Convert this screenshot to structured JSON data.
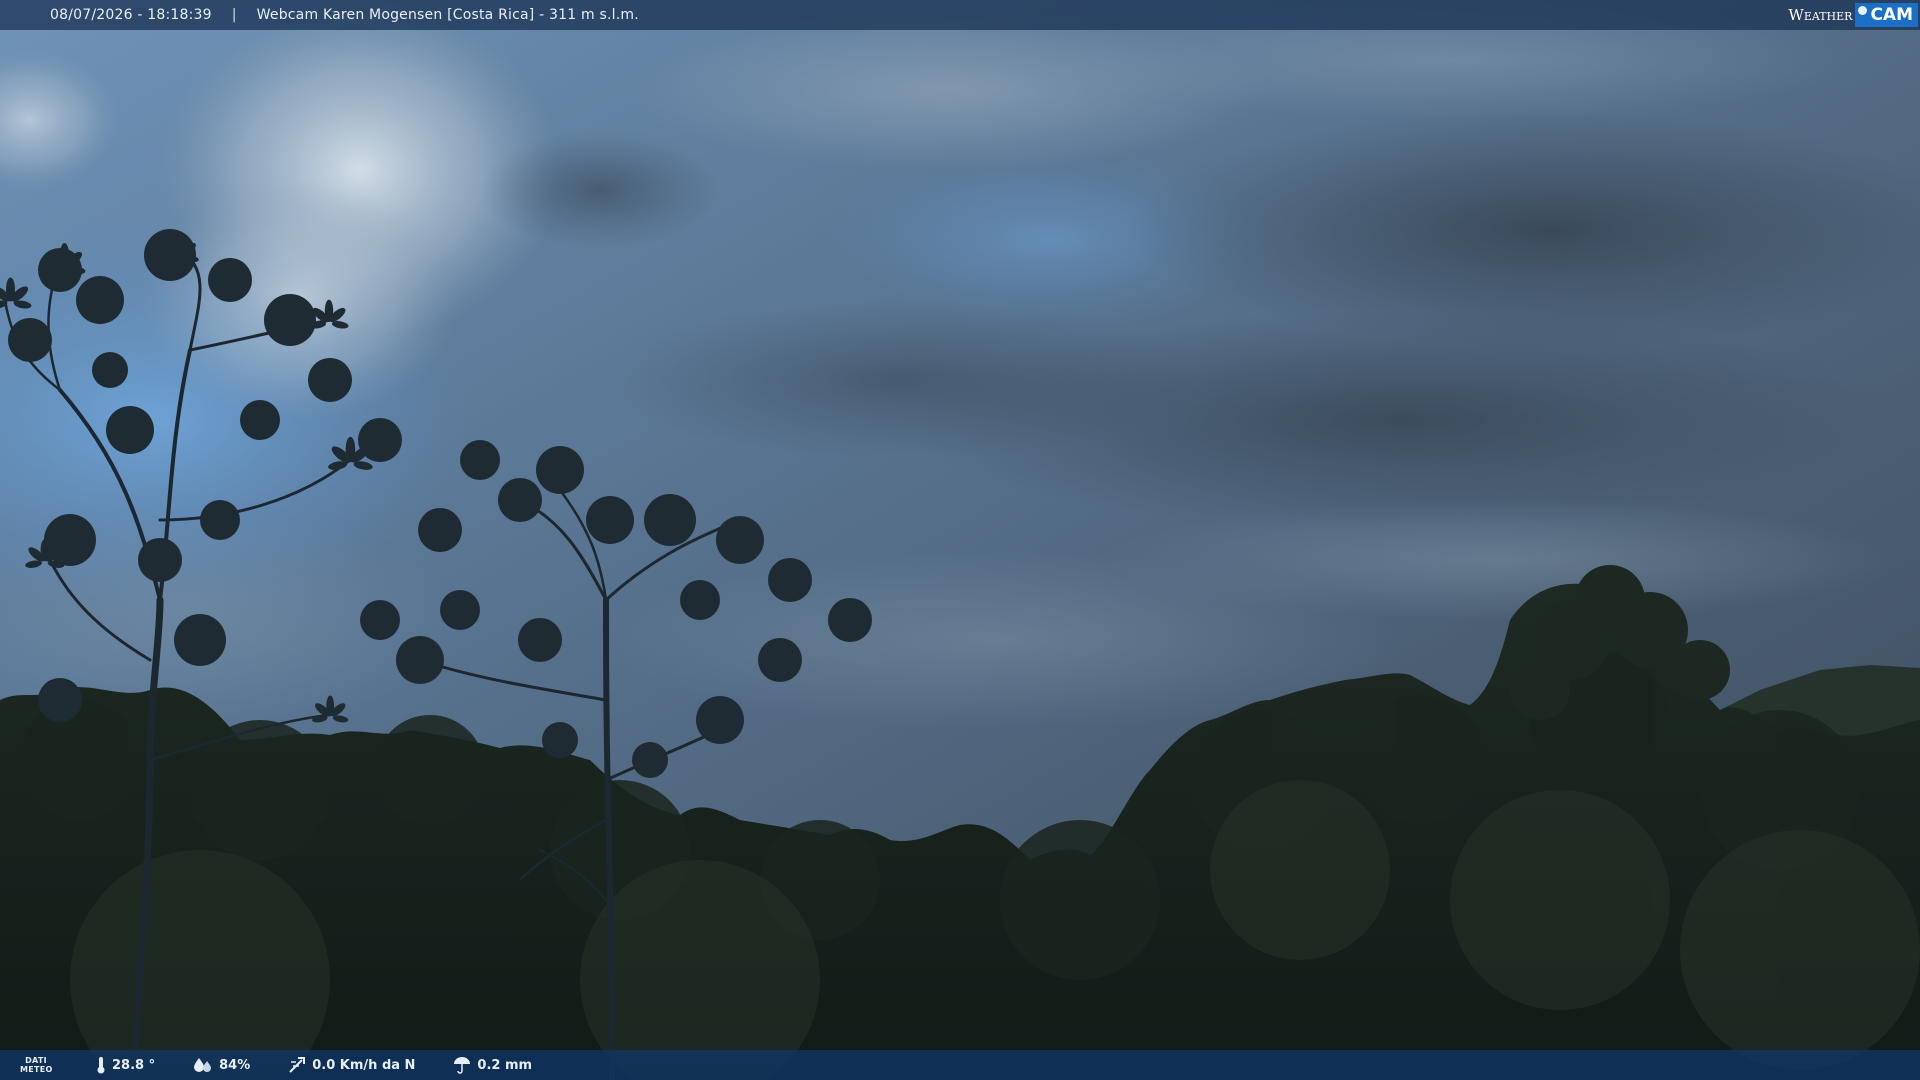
{
  "header": {
    "timestamp": "08/07/2026 - 18:18:39",
    "separator": "|",
    "title": "Webcam Karen Mogensen [Costa Rica]  - 311 m s.l.m.",
    "logo_weather": "Weather",
    "logo_cam": "CAM"
  },
  "footer": {
    "label_line1": "DATI",
    "label_line2": "METEO",
    "temperature": "28.8 °",
    "humidity": "84%",
    "wind": "0.0 Km/h da N",
    "rain": "0.2 mm"
  },
  "icons": {
    "temperature": "thermometer-icon",
    "humidity": "humidity-icon",
    "wind": "wind-icon",
    "rain": "umbrella-icon"
  },
  "colors": {
    "bar_top": "#1c3456",
    "bar_bottom": "#103462",
    "logo_accent": "#1c6fc4",
    "sky_light": "#7fa4c8",
    "sky_dark": "#3f5163",
    "forest": "#18241c"
  }
}
